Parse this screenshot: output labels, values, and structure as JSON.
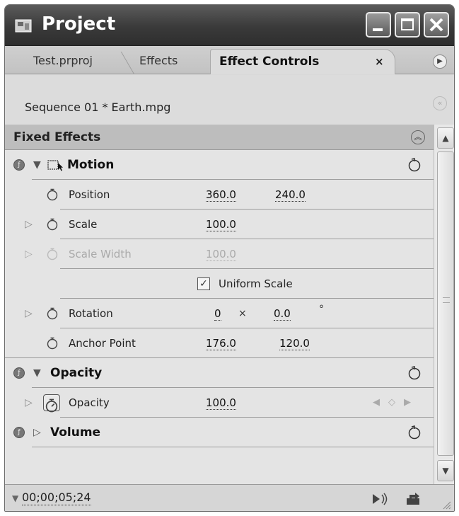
{
  "window": {
    "title": "Project"
  },
  "tabs": [
    {
      "label": "Test.prproj"
    },
    {
      "label": "Effects"
    },
    {
      "label": "Effect Controls",
      "close": "×"
    }
  ],
  "sequence_label": "Sequence 01 * Earth.mpg",
  "fixed_effects_label": "Fixed Effects",
  "motion": {
    "title": "Motion",
    "position": {
      "label": "Position",
      "x": "360.0",
      "y": "240.0"
    },
    "scale": {
      "label": "Scale",
      "value": "100.0"
    },
    "scale_width": {
      "label": "Scale Width",
      "value": "100.0"
    },
    "uniform_scale": {
      "label": "Uniform Scale",
      "checked": true
    },
    "rotation": {
      "label": "Rotation",
      "turns": "0",
      "times": "×",
      "degrees": "0.0",
      "unit": "°"
    },
    "anchor_point": {
      "label": "Anchor Point",
      "x": "176.0",
      "y": "120.0"
    }
  },
  "opacity": {
    "title": "Opacity",
    "property": {
      "label": "Opacity",
      "value": "100.0"
    }
  },
  "volume": {
    "title": "Volume"
  },
  "status": {
    "timecode": "00;00;05;24"
  },
  "icons": {
    "window": [
      "app-icon",
      "minimize-icon",
      "maximize-icon",
      "close-icon"
    ],
    "panel": [
      "panel-menu-icon",
      "collapse-icon",
      "collapse-all-icon",
      "reset-icon",
      "stopwatch-icon",
      "keyframe-nav-icons",
      "play-audio-icon",
      "export-icon"
    ]
  }
}
